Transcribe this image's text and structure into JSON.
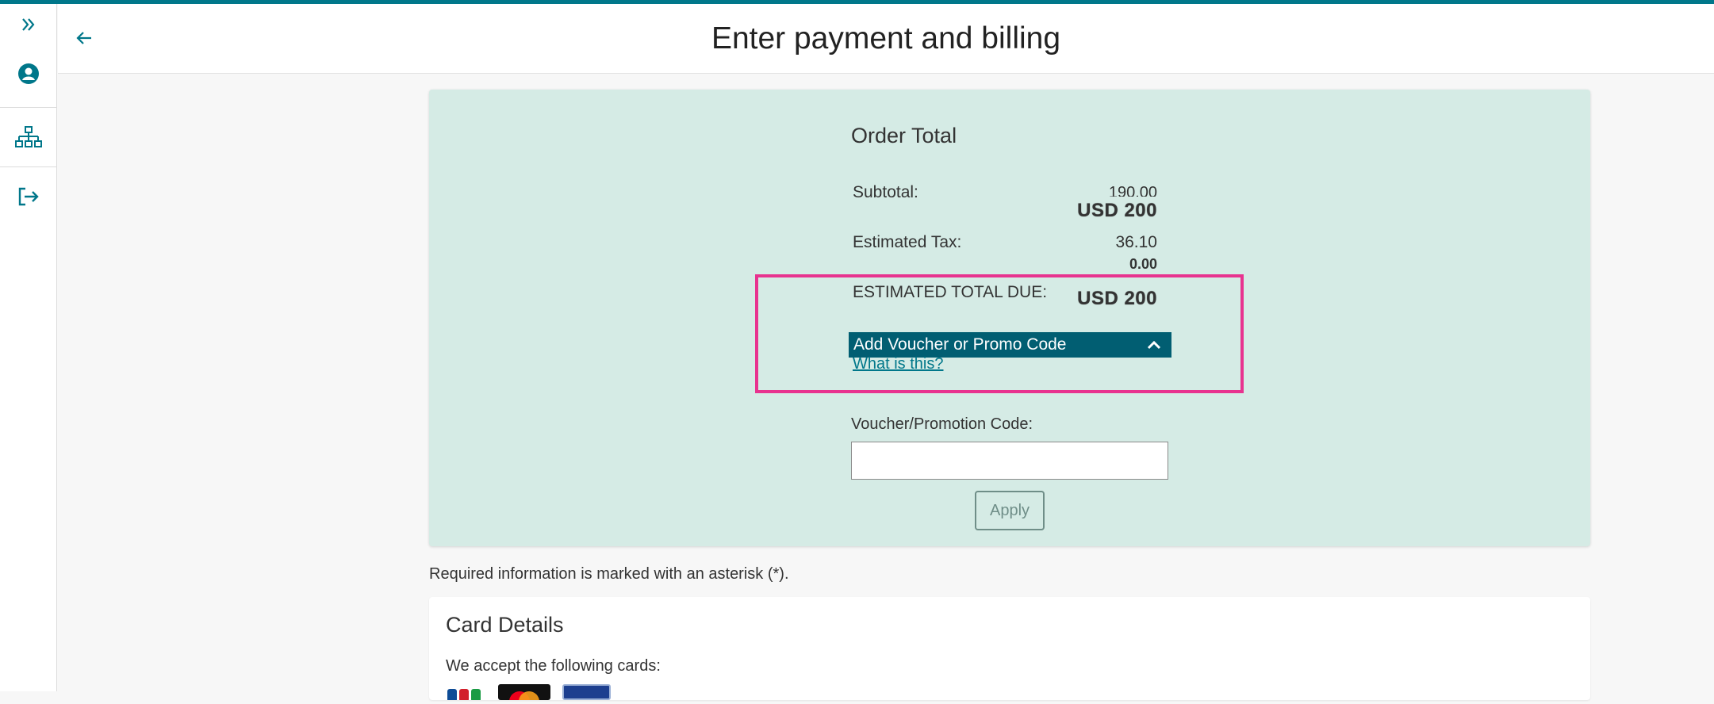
{
  "header": {
    "title": "Enter payment and billing"
  },
  "sidebar": {
    "items": [
      {
        "icon": "expand-chevrons-icon"
      },
      {
        "icon": "user-circle-icon"
      },
      {
        "icon": "sitemap-icon"
      },
      {
        "icon": "sign-out-icon"
      }
    ]
  },
  "order": {
    "title": "Order Total",
    "subtotal_label": "Subtotal:",
    "subtotal_original": "190.00",
    "subtotal_value": "USD 200",
    "tax_label": "Estimated Tax:",
    "tax_original": "36.10",
    "tax_value": "0.00",
    "total_label": "ESTIMATED TOTAL DUE:",
    "total_value": "USD 200",
    "voucher_toggle_label": "Add Voucher or Promo Code",
    "what_is_this": "What is this?",
    "voucher_field_label": "Voucher/Promotion Code:",
    "voucher_field_value": "",
    "apply_label": "Apply"
  },
  "required_note": "Required information is marked with an asterisk (*).",
  "card": {
    "title": "Card Details",
    "accept_text": "We accept the following cards:",
    "logos": [
      "jcb-logo",
      "mastercard-logo",
      "generic-card-logo"
    ]
  },
  "colors": {
    "accent": "#00778a",
    "voucher_bar": "#015e72",
    "panel_bg": "#d5ebe5",
    "highlight": "#e8338f"
  }
}
